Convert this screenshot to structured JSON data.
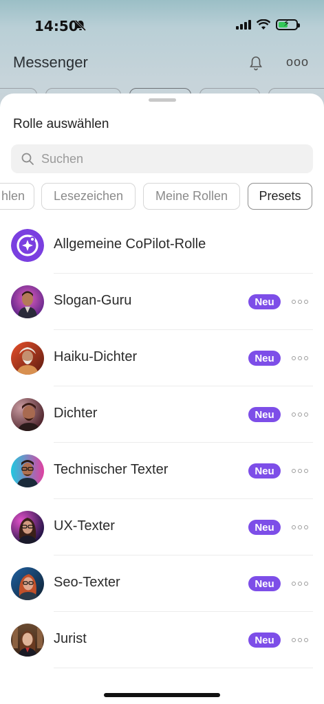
{
  "status_bar": {
    "time": "14:50",
    "battery_color": "#34c759"
  },
  "background_app": {
    "title": "Messenger"
  },
  "sheet": {
    "title": "Rolle auswählen",
    "search": {
      "placeholder": "Suchen",
      "value": ""
    },
    "filters": [
      {
        "label": "hlen",
        "active": false
      },
      {
        "label": "Lesezeichen",
        "active": false
      },
      {
        "label": "Meine Rollen",
        "active": false
      },
      {
        "label": "Presets",
        "active": true
      }
    ],
    "roles": [
      {
        "name": "Allgemeine CoPilot-Rolle",
        "badge": "",
        "avatar": "copilot-logo-icon"
      },
      {
        "name": "Slogan-Guru",
        "badge": "Neu",
        "avatar": "portrait"
      },
      {
        "name": "Haiku-Dichter",
        "badge": "Neu",
        "avatar": "portrait"
      },
      {
        "name": "Dichter",
        "badge": "Neu",
        "avatar": "portrait"
      },
      {
        "name": "Technischer Texter",
        "badge": "Neu",
        "avatar": "portrait"
      },
      {
        "name": "UX-Texter",
        "badge": "Neu",
        "avatar": "portrait"
      },
      {
        "name": "Seo-Texter",
        "badge": "Neu",
        "avatar": "portrait"
      },
      {
        "name": "Jurist",
        "badge": "Neu",
        "avatar": "portrait"
      }
    ]
  },
  "colors": {
    "accent": "#7d4ee8",
    "badge_text": "#ffffff"
  }
}
